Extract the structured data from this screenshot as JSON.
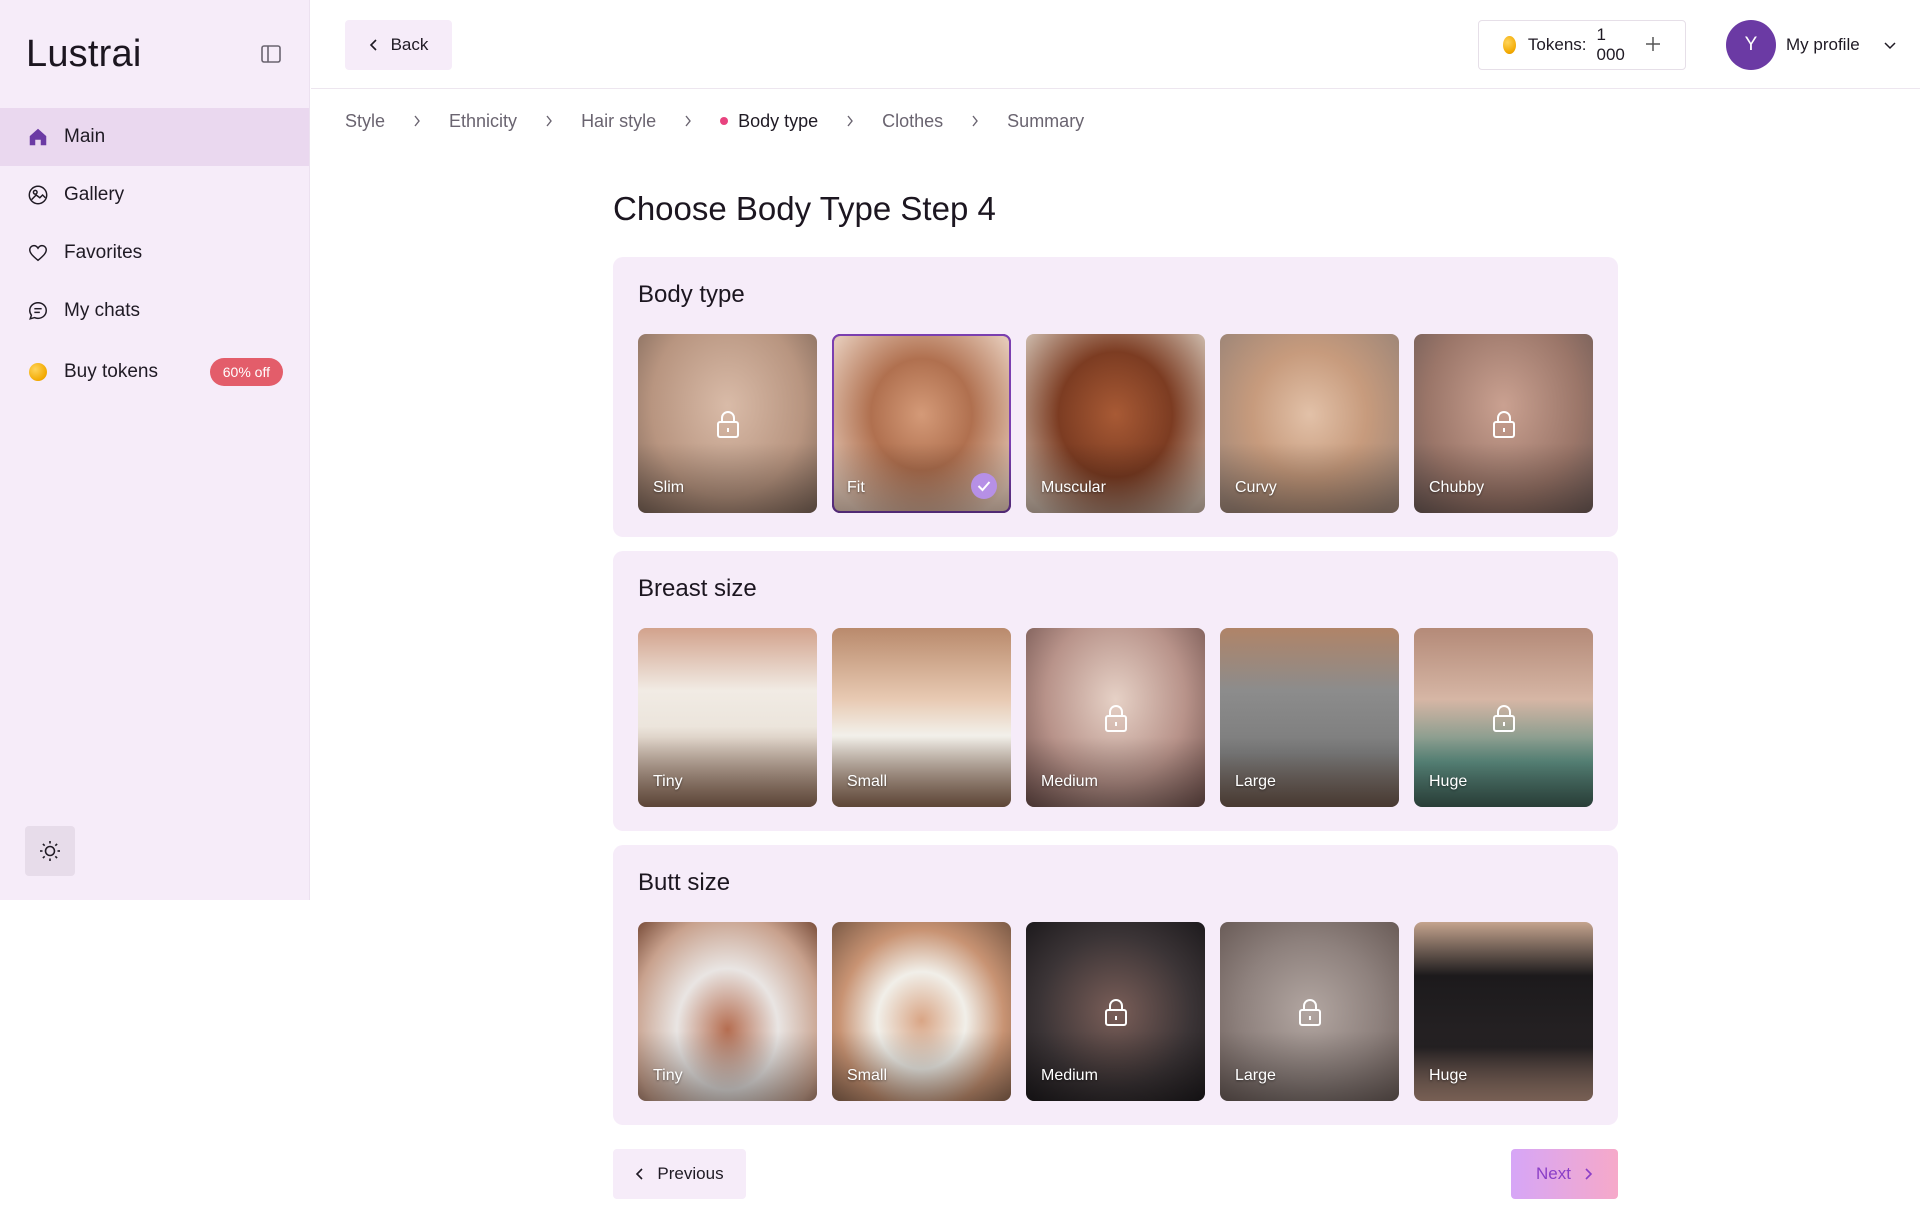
{
  "app": {
    "name": "Lustrai"
  },
  "sidebar": {
    "items": [
      {
        "label": "Main",
        "icon": "home-icon"
      },
      {
        "label": "Gallery",
        "icon": "gallery-icon"
      },
      {
        "label": "Favorites",
        "icon": "heart-icon"
      },
      {
        "label": "My chats",
        "icon": "chat-icon"
      },
      {
        "label": "Buy tokens",
        "icon": "coin-icon",
        "badge": "60% off"
      }
    ]
  },
  "header": {
    "back_label": "Back",
    "tokens_label": "Tokens:",
    "tokens_value": "1 000",
    "avatar_initial": "Y",
    "profile_label": "My profile"
  },
  "breadcrumb": {
    "steps": [
      "Style",
      "Ethnicity",
      "Hair style",
      "Body type",
      "Clothes",
      "Summary"
    ],
    "current": "Body type"
  },
  "page": {
    "title": "Choose Body Type Step 4"
  },
  "sections": [
    {
      "title": "Body type",
      "options": [
        {
          "label": "Slim",
          "locked": true,
          "selected": false
        },
        {
          "label": "Fit",
          "locked": false,
          "selected": true
        },
        {
          "label": "Muscular",
          "locked": false,
          "selected": false
        },
        {
          "label": "Curvy",
          "locked": false,
          "selected": false
        },
        {
          "label": "Chubby",
          "locked": true,
          "selected": false
        }
      ]
    },
    {
      "title": "Breast size",
      "options": [
        {
          "label": "Tiny",
          "locked": false,
          "selected": false
        },
        {
          "label": "Small",
          "locked": false,
          "selected": false
        },
        {
          "label": "Medium",
          "locked": true,
          "selected": false
        },
        {
          "label": "Large",
          "locked": false,
          "selected": false
        },
        {
          "label": "Huge",
          "locked": true,
          "selected": false
        }
      ]
    },
    {
      "title": "Butt size",
      "options": [
        {
          "label": "Tiny",
          "locked": false,
          "selected": false
        },
        {
          "label": "Small",
          "locked": false,
          "selected": false
        },
        {
          "label": "Medium",
          "locked": true,
          "selected": false
        },
        {
          "label": "Large",
          "locked": true,
          "selected": false
        },
        {
          "label": "Huge",
          "locked": false,
          "selected": false
        }
      ]
    }
  ],
  "footer": {
    "previous_label": "Previous",
    "next_label": "Next"
  },
  "colors": {
    "sidebar_bg": "#f6ecf9",
    "accent_purple": "#6b3aa4",
    "badge_red": "#e35d6a",
    "crumb_dot": "#e8437f"
  }
}
